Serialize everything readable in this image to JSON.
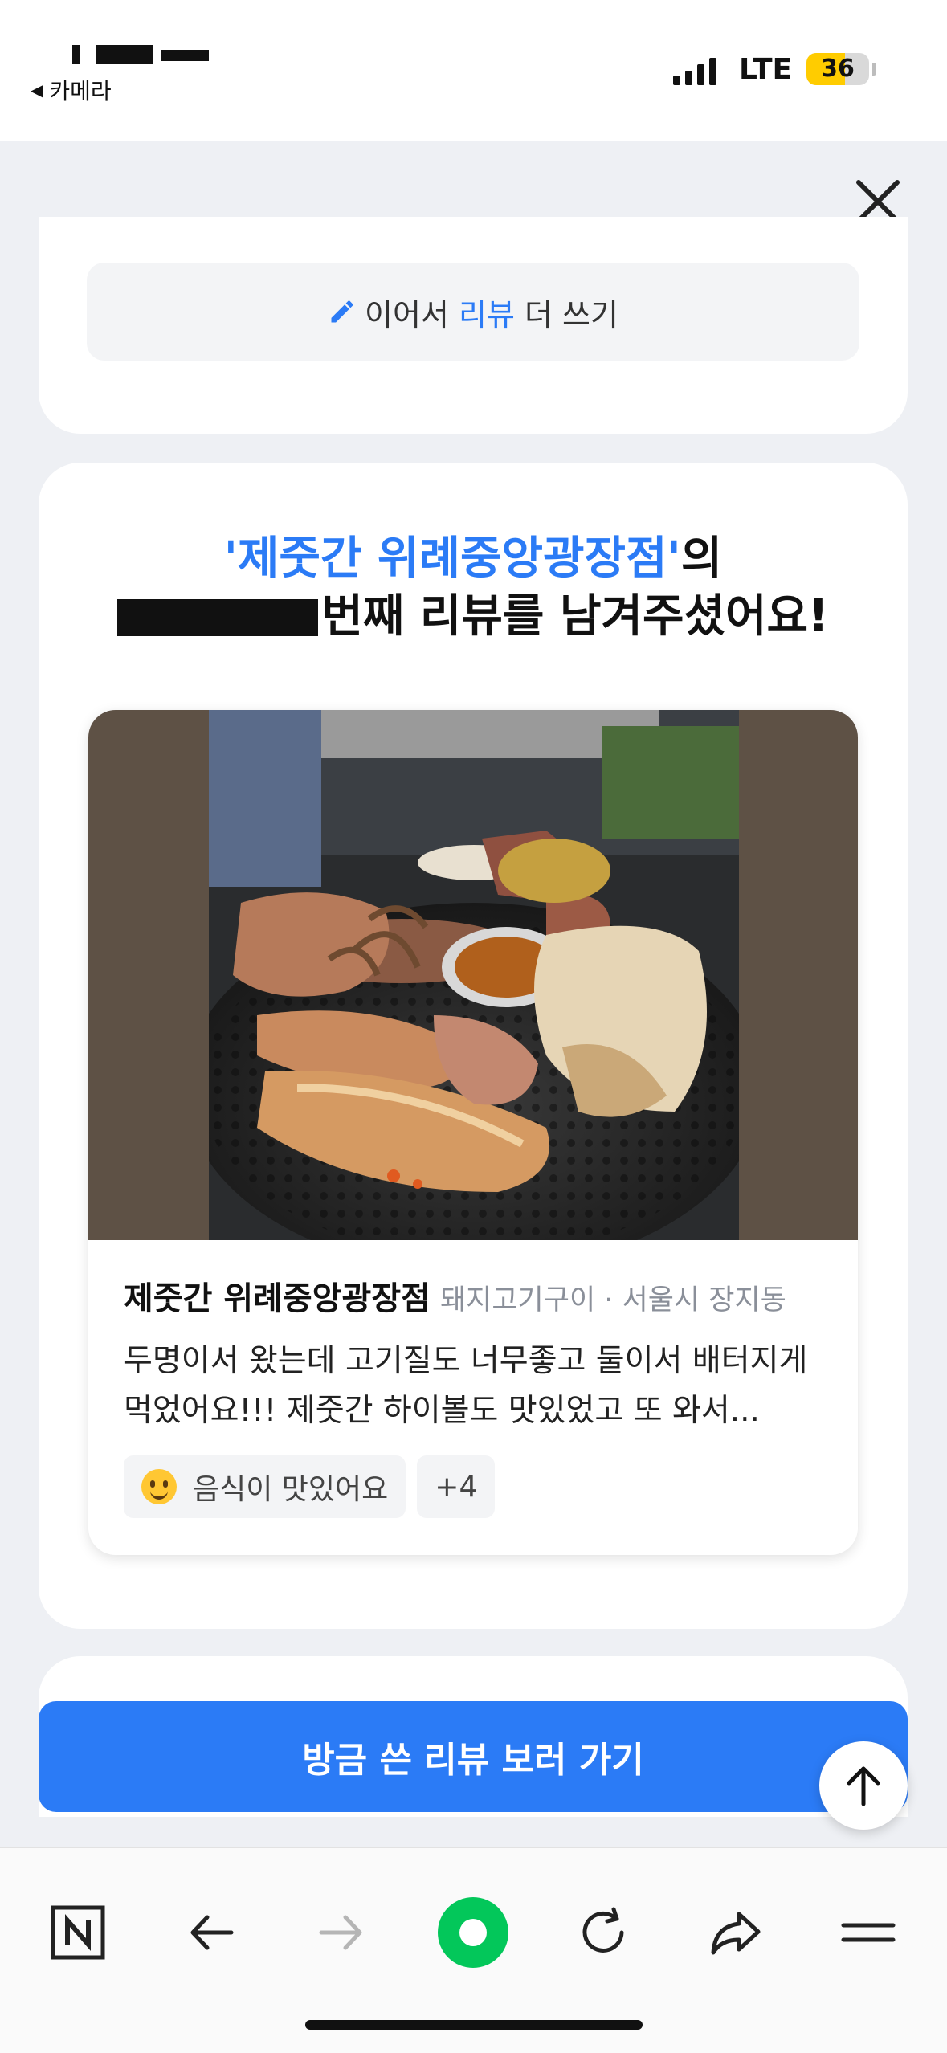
{
  "status_bar": {
    "back_app": "카메라",
    "network": "LTE",
    "battery_level": "36"
  },
  "top_card": {
    "continue_prefix": "이어서",
    "continue_highlight": "리뷰",
    "continue_suffix": "더 쓰기"
  },
  "headline": {
    "store": "'제줏간 위례중앙광장점'",
    "line1_suffix": "의",
    "line2": "번째 리뷰를 남겨주셨어요!"
  },
  "review": {
    "store_name": "제줏간 위례중앙광장점",
    "store_meta": "돼지고기구이 · 서울시 장지동",
    "text": "두명이서 왔는데 고기질도 너무좋고 둘이서 배터지게 먹었어요!!! 제줏간 하이볼도 맛있었고 또 와서...",
    "tags": [
      "음식이 맛있어요",
      "+4"
    ]
  },
  "cta": {
    "label": "방금 쓴 리뷰 보러 가기"
  },
  "colors": {
    "accent": "#2b7bf6",
    "battery": "#ffcc00",
    "naver_green": "#03c75a"
  },
  "icons": {
    "toolbar": [
      "naver-n-icon",
      "back-arrow-icon",
      "forward-arrow-icon",
      "home-green-icon",
      "refresh-icon",
      "share-icon",
      "menu-icon"
    ],
    "other": [
      "close-icon",
      "pencil-icon",
      "smile-emoji-icon",
      "arrow-up-icon"
    ]
  }
}
